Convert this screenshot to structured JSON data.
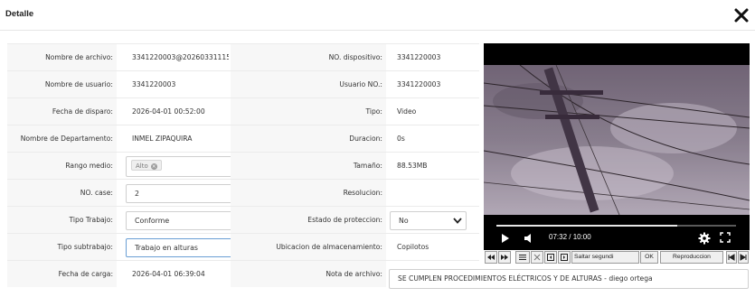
{
  "dialog": {
    "title": "Detalle",
    "close_icon": "close-icon"
  },
  "fields": {
    "nombre_archivo": {
      "label": "Nombre de archivo:",
      "value": "3341220003@20260331115:"
    },
    "no_dispositivo": {
      "label": "NO. dispositivo:",
      "value": "3341220003"
    },
    "nombre_usuario": {
      "label": "Nombre de usuario:",
      "value": "3341220003"
    },
    "usuario_no": {
      "label": "Usuario NO.:",
      "value": "3341220003"
    },
    "fecha_disparo": {
      "label": "Fecha de disparo:",
      "value": "2026-04-01 00:52:00"
    },
    "tipo": {
      "label": "Tipo:",
      "value": "Video"
    },
    "departamento": {
      "label": "Nombre de Departamento:",
      "value": "INMEL ZIPAQUIRA"
    },
    "duracion": {
      "label": "Duracion:",
      "value": "0s"
    },
    "rango_medio": {
      "label": "Rango medio:",
      "tag": "Alto"
    },
    "tamano": {
      "label": "Tamaño:",
      "value": "88.53MB"
    },
    "no_case": {
      "label": "NO. case:",
      "value": "2"
    },
    "resolucion": {
      "label": "Resolucion:",
      "value": ""
    },
    "tipo_trabajo": {
      "label": "Tipo Trabajo:",
      "value": "Conforme"
    },
    "estado_proteccion": {
      "label": "Estado de proteccion:",
      "value": "No"
    },
    "tipo_subtrabajo": {
      "label": "Tipo subtrabajo:",
      "value": "Trabajo en alturas"
    },
    "ubicacion": {
      "label": "Ubicacion de almacenamiento:",
      "value": "Copilotos"
    },
    "fecha_carga": {
      "label": "Fecha de carga:",
      "value": "2026-04-01 06:39:04"
    },
    "nota_archivo": {
      "label": "Nota de archivo:",
      "value": "SE CUMPLEN PROCEDIMIENTOS ELÉCTRICOS Y DE ALTURAS - diego ortega"
    }
  },
  "player": {
    "time": "07:32 / 10:00",
    "progress": 0.753,
    "toolbar": {
      "skip_label": "Saltar segundi",
      "ok_label": "OK",
      "playback_label": "Reproduccion"
    }
  },
  "colors": {
    "label_bg": "#f7f7f7",
    "border": "#cfcfcf",
    "player_bg": "#000000"
  }
}
